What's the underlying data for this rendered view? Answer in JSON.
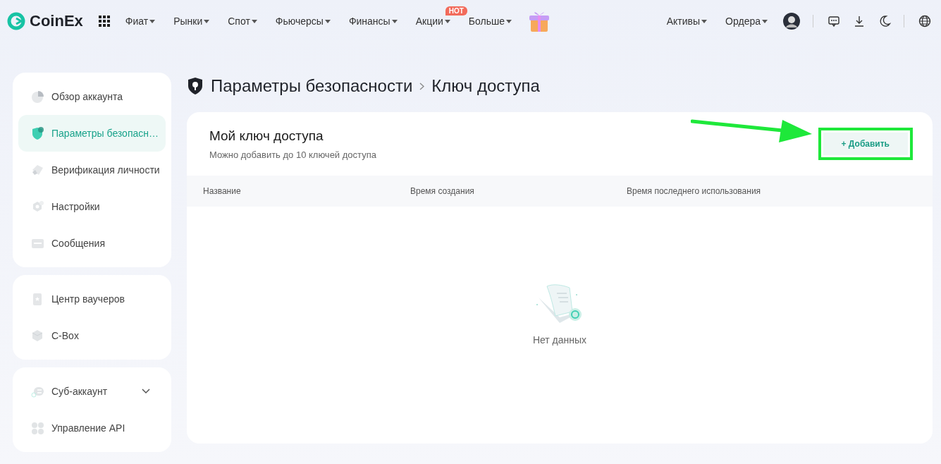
{
  "brand": {
    "name": "CoinEx"
  },
  "nav": [
    {
      "label": "Фиат"
    },
    {
      "label": "Рынки"
    },
    {
      "label": "Спот"
    },
    {
      "label": "Фьючерсы"
    },
    {
      "label": "Финансы"
    },
    {
      "label": "Акции",
      "badge": "HOT"
    },
    {
      "label": "Больше"
    }
  ],
  "nav_right": [
    {
      "label": "Активы"
    },
    {
      "label": "Ордера"
    }
  ],
  "sidebar": [
    {
      "items": [
        {
          "label": "Обзор аккаунта",
          "selected": false
        },
        {
          "label": "Параметры безопасн…",
          "selected": true
        },
        {
          "label": "Верификация личности",
          "selected": false
        },
        {
          "label": "Настройки",
          "selected": false
        },
        {
          "label": "Сообщения",
          "selected": false
        }
      ]
    },
    {
      "items": [
        {
          "label": "Центр ваучеров",
          "selected": false
        },
        {
          "label": "C-Box",
          "selected": false
        }
      ]
    },
    {
      "items": [
        {
          "label": "Суб-аккаунт",
          "selected": false,
          "expanded": false
        },
        {
          "label": "Управление API",
          "selected": false
        }
      ]
    }
  ],
  "breadcrumb": [
    "Параметры безопасности",
    "Ключ доступа"
  ],
  "panel": {
    "title": "Мой ключ доступа",
    "subtitle": "Можно добавить до 10 ключей доступа",
    "add_button": "+ Добавить",
    "table": {
      "columns": [
        "Название",
        "Время создания",
        "Время последнего использования"
      ]
    },
    "empty_text": "Нет данных"
  }
}
